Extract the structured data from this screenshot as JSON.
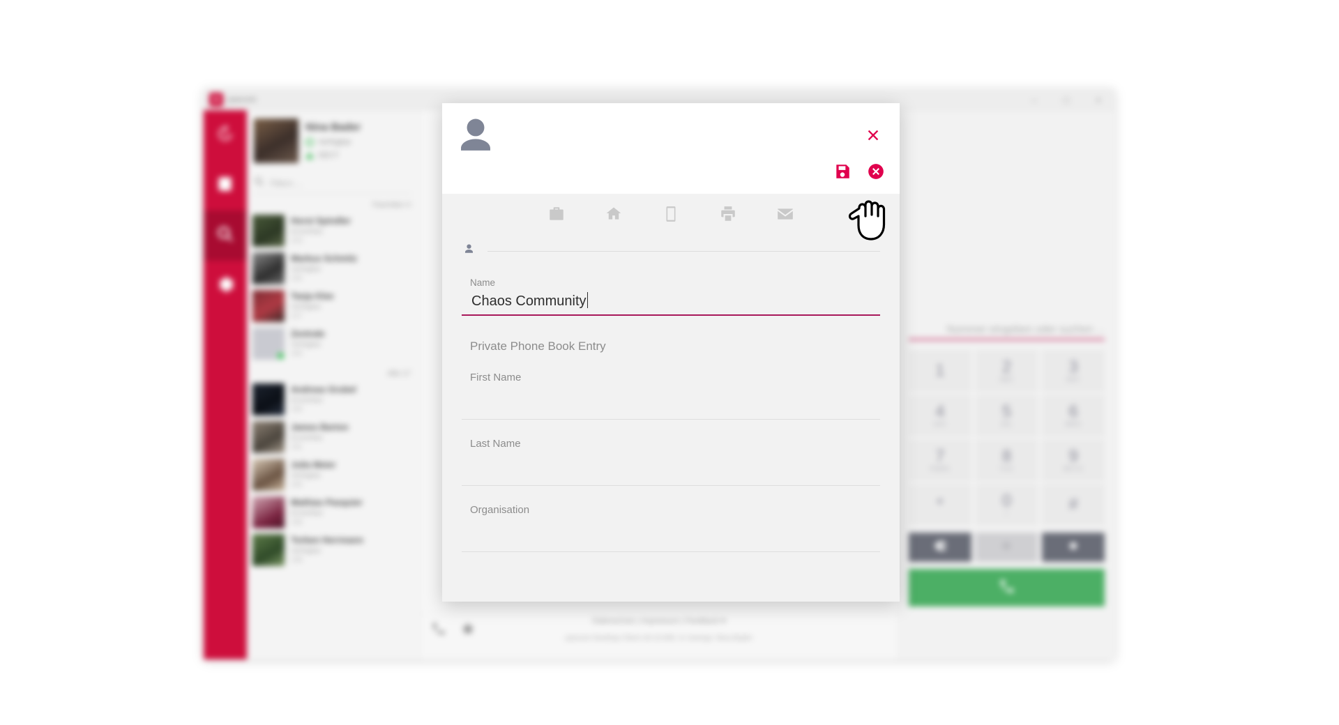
{
  "app": {
    "title": "pascom",
    "logo_glyph": "■",
    "window_controls": [
      {
        "name": "minimize",
        "glyph": "–"
      },
      {
        "name": "maximize",
        "glyph": "□"
      },
      {
        "name": "close",
        "glyph": "×"
      }
    ],
    "rail": [
      {
        "name": "history",
        "icon": "clock-history-icon",
        "active": false
      },
      {
        "name": "contacts",
        "icon": "address-book-icon",
        "active": false
      },
      {
        "name": "search",
        "icon": "search-icon",
        "active": true
      },
      {
        "name": "settings",
        "icon": "gear-icon",
        "active": false
      }
    ],
    "me": {
      "name": "Nina Bader",
      "status": "Verfügbar",
      "device": "DECT"
    },
    "filter": {
      "placeholder": "Filtern ..."
    },
    "groups": [
      {
        "label": "Favoriten",
        "count": "4"
      },
      {
        "label": "Alle",
        "count": "17"
      }
    ],
    "contacts": [
      {
        "name": "Horst Spindler",
        "status": "Erreichbar",
        "ext": "223",
        "avatar": "linear-gradient(150deg,#4a5b3a,#2c3824 60%,#5d6a4a)"
      },
      {
        "name": "Markus Schmitz",
        "status": "Verfügbar",
        "ext": "225",
        "avatar": "linear-gradient(150deg,#8a8a8a,#2e2e2e 60%,#6e6e6e)"
      },
      {
        "name": "Tanja Klee",
        "status": "Verfügbar",
        "ext": "227",
        "avatar": "linear-gradient(150deg,#7d2c33,#b03a44 55%,#3a2a28)"
      },
      {
        "name": "Zentrale",
        "status": "Verfügbar",
        "ext": "200",
        "avatar": "#c9cad1",
        "badge": true
      },
      {
        "name": "Andreas Grubel",
        "status": "Erreichbar",
        "ext": "230",
        "avatar": "linear-gradient(150deg,#1d2430,#0b0f16 60%,#2b3444)"
      },
      {
        "name": "James Barton",
        "status": "Erreichbar",
        "ext": "231",
        "avatar": "linear-gradient(150deg,#8e8275,#4b453d 60%,#a59a8c)"
      },
      {
        "name": "Julia Meier",
        "status": "Verfügbar",
        "ext": "234",
        "avatar": "linear-gradient(150deg,#d8c9b6,#6a5342 60%,#cbb79f)"
      },
      {
        "name": "Mathias Pasquier",
        "status": "Erreichbar",
        "ext": "236",
        "avatar": "linear-gradient(150deg,#d2a8b4,#7a2340 65%,#4a1426)"
      },
      {
        "name": "Torben Herrmann",
        "status": "Verfügbar",
        "ext": "238",
        "avatar": "linear-gradient(150deg,#5f7d4a,#2f4a28 60%,#7e9a66)"
      }
    ],
    "detail": {
      "badge_name": "presence-badge"
    },
    "footer": {
      "links": "Datenschutz  |  Impressum  |  Feedback ♥",
      "version": "pascom Desktop Client v8.13.005, in Usertyp: Nina Bader"
    },
    "dialpad": {
      "input_placeholder": "Nummer eingeben oder suchen ...",
      "keys": [
        {
          "digit": "1",
          "letters": ""
        },
        {
          "digit": "2",
          "letters": "ABC"
        },
        {
          "digit": "3",
          "letters": "DEF"
        },
        {
          "digit": "4",
          "letters": "GHI"
        },
        {
          "digit": "5",
          "letters": "JKL"
        },
        {
          "digit": "6",
          "letters": "MNO"
        },
        {
          "digit": "7",
          "letters": "PQRS"
        },
        {
          "digit": "8",
          "letters": "TUV"
        },
        {
          "digit": "9",
          "letters": "WXYZ"
        },
        {
          "digit": "*",
          "letters": ""
        },
        {
          "digit": "0",
          "letters": "+"
        },
        {
          "digit": "#",
          "letters": ""
        }
      ],
      "actions": [
        {
          "name": "backspace",
          "icon": "backspace-icon",
          "style": "dark"
        },
        {
          "name": "video",
          "icon": "video-icon",
          "style": "light"
        },
        {
          "name": "record",
          "icon": "record-icon",
          "style": "dark"
        }
      ],
      "call_button": {
        "name": "call-button",
        "icon": "phone-icon",
        "color": "#4caf65"
      }
    }
  },
  "dialog": {
    "avatar_icon": "user-avatar-icon",
    "close_label": "✕",
    "actions": [
      {
        "name": "save",
        "icon": "floppy-save-icon"
      },
      {
        "name": "cancel",
        "icon": "cancel-circle-icon"
      }
    ],
    "tabs": [
      {
        "name": "work",
        "icon": "briefcase-icon"
      },
      {
        "name": "home",
        "icon": "home-icon"
      },
      {
        "name": "mobile",
        "icon": "mobile-icon"
      },
      {
        "name": "fax",
        "icon": "printer-icon"
      },
      {
        "name": "email",
        "icon": "envelope-icon"
      }
    ],
    "owner_field": {
      "icon": "person-icon",
      "value": "",
      "placeholder": ""
    },
    "fields": [
      {
        "label": "Name",
        "value": "Chaos Community",
        "active": true
      }
    ],
    "section_title": "Private Phone Book Entry",
    "sub_fields": [
      {
        "label": "First Name",
        "value": ""
      },
      {
        "label": "Last Name",
        "value": ""
      },
      {
        "label": "Organisation",
        "value": ""
      }
    ]
  },
  "colors": {
    "brand_red": "#ce0e3c",
    "accent_pink": "#e0004d",
    "field_underline_active": "#a8185a",
    "call_green": "#4caf65"
  },
  "cursor": {
    "name": "pointing-hand-cursor"
  }
}
